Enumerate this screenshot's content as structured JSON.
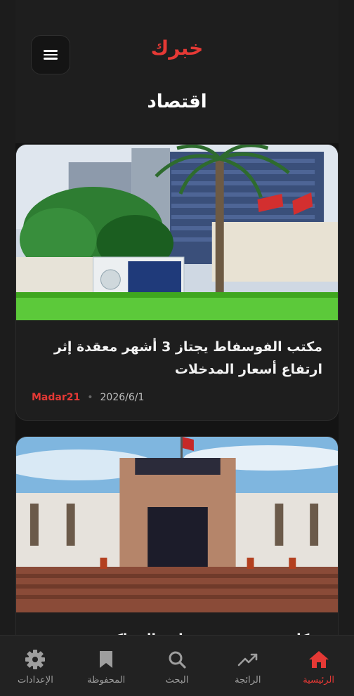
{
  "header": {
    "logo": "خبرك",
    "title": "اقتصاد"
  },
  "articles": [
    {
      "title": "مكتب الفوسفاط يجتاز 3 أشهر معقدة إثر ارتفاع أسعار المدخلات",
      "source": "Madar21",
      "date": "2026/6/1",
      "image": "phosphate-office-building-with-palm-tree"
    },
    {
      "title": "شكاية تفجر قضية تتعلق بالمحاكم",
      "image": "court-building-with-flag"
    }
  ],
  "nav": {
    "items": [
      {
        "label": "الرئيسية",
        "icon": "home-icon",
        "active": true
      },
      {
        "label": "الرائجة",
        "icon": "trending-icon",
        "active": false
      },
      {
        "label": "البحث",
        "icon": "search-icon",
        "active": false
      },
      {
        "label": "المحفوظة",
        "icon": "bookmark-icon",
        "active": false
      },
      {
        "label": "الإعدادات",
        "icon": "gear-icon",
        "active": false
      }
    ]
  },
  "colors": {
    "accent": "#e53935",
    "background": "#141414",
    "card": "#1e1e1e"
  }
}
